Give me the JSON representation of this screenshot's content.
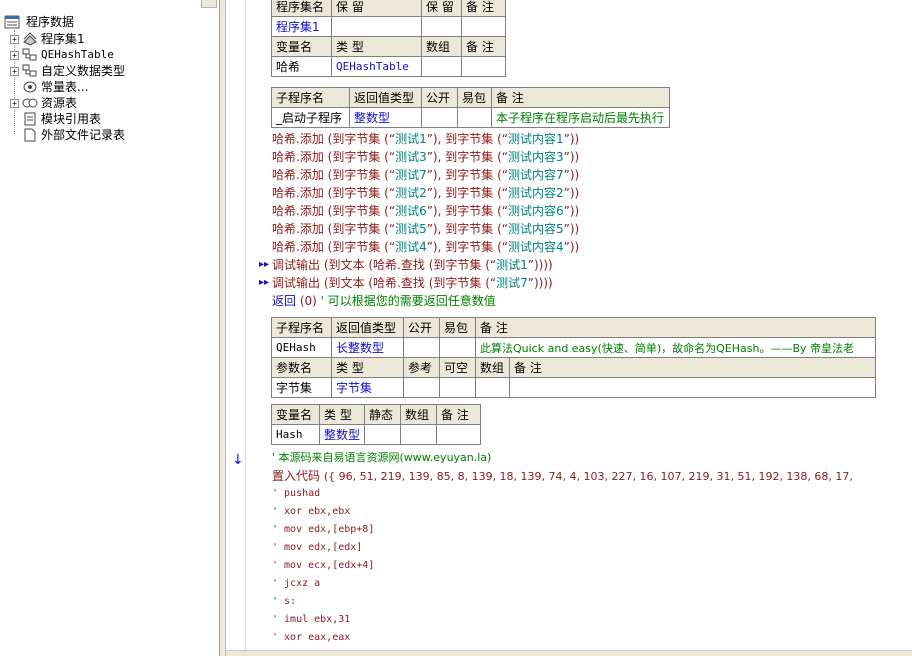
{
  "tree": {
    "root": "程序数据",
    "items": [
      {
        "label": "程序集1",
        "icon": "module-icon",
        "expandable": true
      },
      {
        "label": "QEHashTable",
        "icon": "class-icon",
        "expandable": true
      },
      {
        "label": "自定义数据类型",
        "icon": "datatype-icon",
        "expandable": true
      },
      {
        "label": "常量表...",
        "icon": "constant-icon",
        "expandable": false
      },
      {
        "label": "资源表",
        "icon": "resource-icon",
        "expandable": true
      },
      {
        "label": "模块引用表",
        "icon": "module-ref-icon",
        "expandable": false
      },
      {
        "label": "外部文件记录表",
        "icon": "file-icon",
        "expandable": false
      }
    ]
  },
  "assembly_table": {
    "headers": [
      "程序集名",
      "保 留",
      "保 留",
      "备 注"
    ],
    "row": [
      "程序集1",
      "",
      "",
      ""
    ],
    "var_headers": [
      "变量名",
      "类 型",
      "数组",
      "备 注"
    ],
    "var_row": [
      "哈希",
      "QEHashTable",
      "",
      ""
    ]
  },
  "sub1_table": {
    "headers": [
      "子程序名",
      "返回值类型",
      "公开",
      "易包",
      "备 注"
    ],
    "row": [
      "_启动子程序",
      "整数型",
      "",
      "",
      "本子程序在程序启动后最先执行"
    ]
  },
  "code_lines": [
    {
      "obj": "哈希",
      "method": ".添加",
      "k": "测试1",
      "v": "测试内容1"
    },
    {
      "obj": "哈希",
      "method": ".添加",
      "k": "测试3",
      "v": "测试内容3"
    },
    {
      "obj": "哈希",
      "method": ".添加",
      "k": "测试7",
      "v": "测试内容7"
    },
    {
      "obj": "哈希",
      "method": ".添加",
      "k": "测试2",
      "v": "测试内容2"
    },
    {
      "obj": "哈希",
      "method": ".添加",
      "k": "测试6",
      "v": "测试内容6"
    },
    {
      "obj": "哈希",
      "method": ".添加",
      "k": "测试5",
      "v": "测试内容5"
    },
    {
      "obj": "哈希",
      "method": ".添加",
      "k": "测试4",
      "v": "测试内容4"
    }
  ],
  "fn_to_bytes": "到字节集",
  "fn_to_text": "到文本",
  "debug_lines": [
    {
      "cmd": "调试输出",
      "key": "测试1"
    },
    {
      "cmd": "调试输出",
      "key": "测试7"
    }
  ],
  "find_call": "哈希.查找",
  "return_line": {
    "kw": "返回",
    "val": "(0)",
    "comment": "' 可以根据您的需要返回任意数值"
  },
  "sub2_table": {
    "headers": [
      "子程序名",
      "返回值类型",
      "公开",
      "易包",
      "备 注"
    ],
    "row": [
      "QEHash",
      "长整数型",
      "",
      "",
      "此算法Quick and easy(快速、简单)，故命名为QEHash。——By 帝皇法老"
    ],
    "param_headers": [
      "参数名",
      "类 型",
      "参考",
      "可空",
      "数组",
      "备 注"
    ],
    "param_row": [
      "字节集",
      "字节集",
      "",
      "",
      "",
      ""
    ]
  },
  "local_table": {
    "headers": [
      "变量名",
      "类 型",
      "静态",
      "数组",
      "备 注"
    ],
    "row": [
      "Hash",
      "整数型",
      "",
      "",
      ""
    ]
  },
  "source_comment": "' 本源码来自易语言资源网(www.eyuyan.la)",
  "embed_line": {
    "kw": "置入代码",
    "bytes": "({ 96, 51, 219, 139, 85, 8, 139, 18, 139, 74, 4, 103, 227, 16, 107, 219, 31, 51, 192, 138, 68, 17,"
  },
  "asm_lines": [
    "' pushad",
    "' xor ebx,ebx",
    "' mov edx,[ebp+8]",
    "' mov edx,[edx]",
    "' mov ecx,[edx+4]",
    "' jcxz a",
    "' s:",
    "' imul ebx,31",
    "' xor eax,eax"
  ]
}
